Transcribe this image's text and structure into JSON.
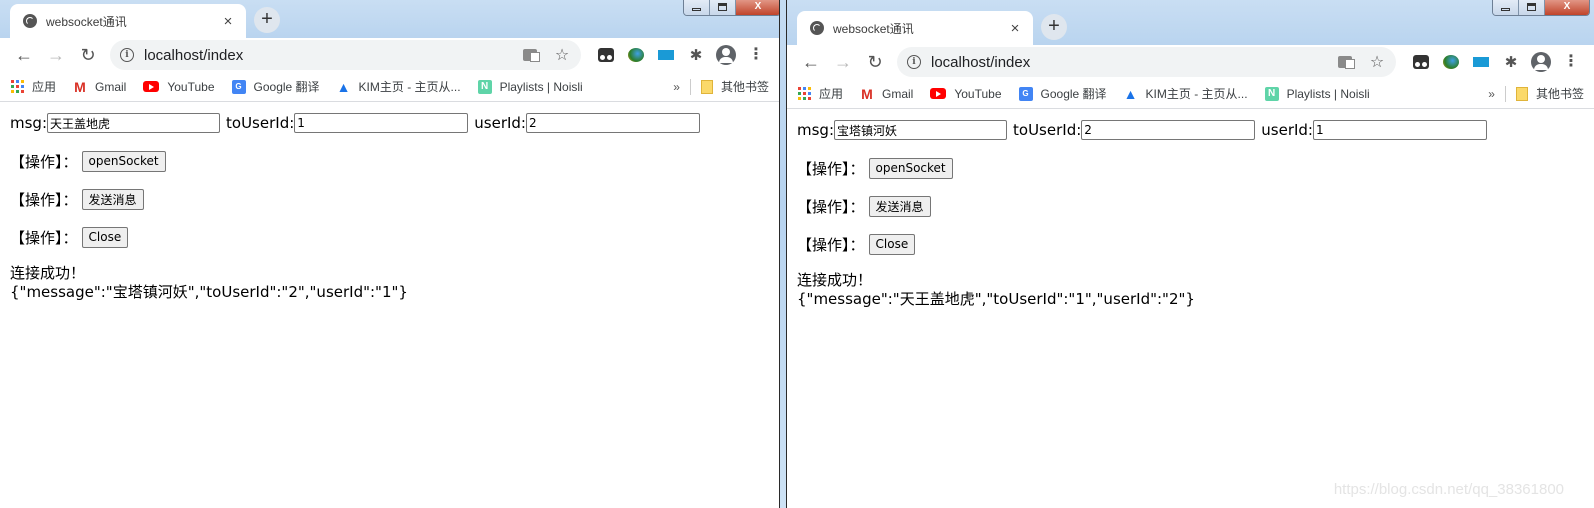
{
  "windows": [
    {
      "tab_title": "websocket通讯",
      "url": "localhost/index",
      "form": {
        "msg_label": "msg:",
        "msg_value": "天王盖地虎",
        "to_user_label": "toUserId:",
        "to_user_value": "1",
        "user_label": "userId:",
        "user_value": "2"
      },
      "operations": [
        {
          "label": "【操作】：",
          "button": "openSocket"
        },
        {
          "label": "【操作】：",
          "button": "发送消息"
        },
        {
          "label": "【操作】：",
          "button": "Close"
        }
      ],
      "output": [
        "连接成功！",
        "{\"message\":\"宝塔镇河妖\",\"toUserId\":\"2\",\"userId\":\"1\"}"
      ]
    },
    {
      "tab_title": "websocket通讯",
      "url": "localhost/index",
      "form": {
        "msg_label": "msg:",
        "msg_value": "宝塔镇河妖",
        "to_user_label": "toUserId:",
        "to_user_value": "2",
        "user_label": "userId:",
        "user_value": "1"
      },
      "operations": [
        {
          "label": "【操作】：",
          "button": "openSocket"
        },
        {
          "label": "【操作】：",
          "button": "发送消息"
        },
        {
          "label": "【操作】：",
          "button": "Close"
        }
      ],
      "output": [
        "连接成功！",
        "{\"message\":\"天王盖地虎\",\"toUserId\":\"1\",\"userId\":\"2\"}"
      ]
    }
  ],
  "bookmarks": [
    {
      "label": "应用",
      "icon": "apps-grid-icon"
    },
    {
      "label": "Gmail",
      "icon": "gmail-icon"
    },
    {
      "label": "YouTube",
      "icon": "youtube-icon"
    },
    {
      "label": "Google 翻译",
      "icon": "google-translate-icon"
    },
    {
      "label": "KIM主页 - 主页从...",
      "icon": "kim-icon"
    },
    {
      "label": "Playlists | Noisli",
      "icon": "noisli-icon"
    }
  ],
  "bookmarks_more": "»",
  "other_bookmarks": "其他书签",
  "glyphs": {
    "back": "←",
    "forward": "→",
    "reload": "↻",
    "info": "i",
    "star": "☆",
    "close": "×",
    "newtab": "+",
    "puzzle": "✱",
    "menu": "⋮",
    "gmail": "M",
    "gtrans": "G",
    "kim": "▲",
    "noisli": "N",
    "win_close": "X"
  },
  "watermark": "https://blog.csdn.net/qq_38361800",
  "colors": {
    "apps": [
      "#ea4335",
      "#4285f4",
      "#fbbc04",
      "#34a853",
      "#ea4335",
      "#4285f4",
      "#fbbc04",
      "#34a853",
      "#ea4335"
    ]
  }
}
